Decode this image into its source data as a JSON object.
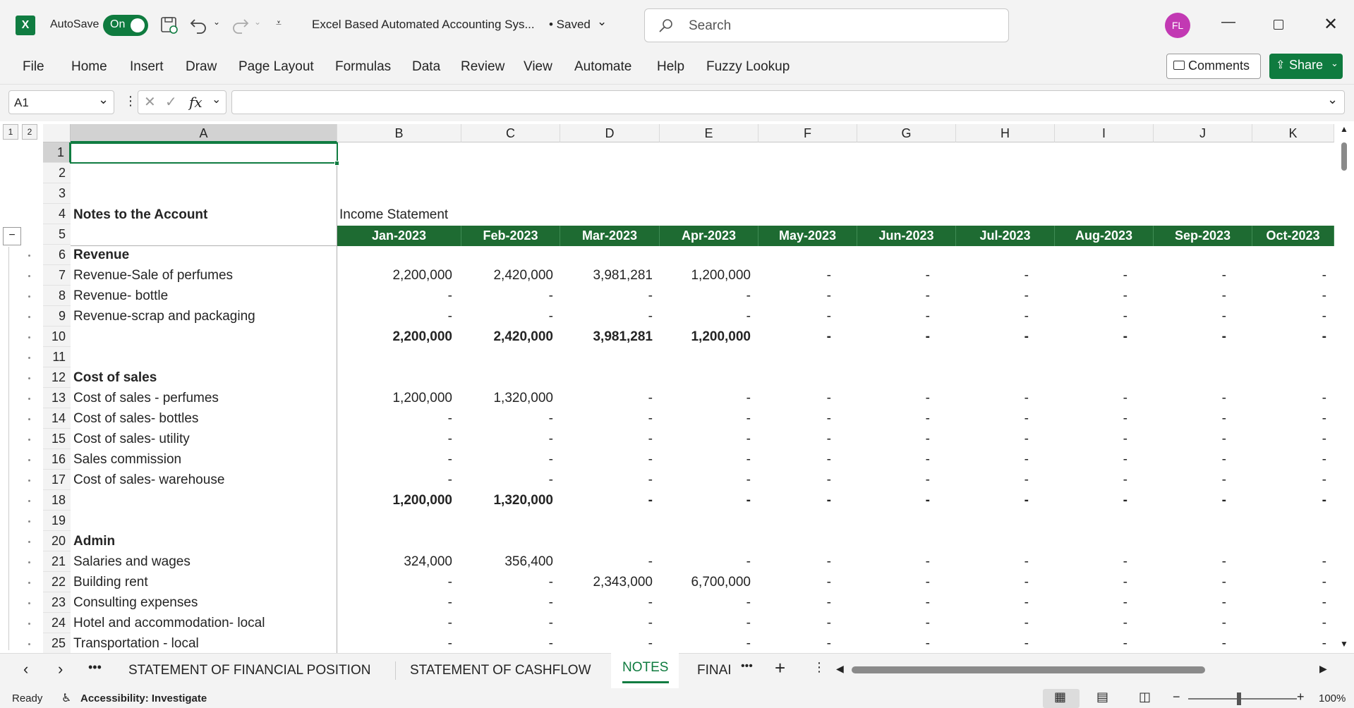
{
  "titlebar": {
    "autosave_label": "AutoSave",
    "autosave_state": "On",
    "doc_title": "Excel Based Automated Accounting Sys...",
    "save_status": "• Saved",
    "search_placeholder": "Search",
    "user_initials": "FL"
  },
  "menu": [
    "File",
    "Home",
    "Insert",
    "Draw",
    "Page Layout",
    "Formulas",
    "Data",
    "Review",
    "View",
    "Automate",
    "Help",
    "Fuzzy Lookup"
  ],
  "buttons": {
    "comments": "Comments",
    "share": "Share"
  },
  "formula_bar": {
    "name_box": "A1",
    "fx": "fx",
    "formula": ""
  },
  "outline_levels": [
    "1",
    "2"
  ],
  "columns": [
    "A",
    "B",
    "C",
    "D",
    "E",
    "F",
    "G",
    "H",
    "I",
    "J",
    "K"
  ],
  "sheet_heading_a": "Notes to the Account",
  "sheet_heading_b": "Income Statement",
  "months": [
    "Jan-2023",
    "Feb-2023",
    "Mar-2023",
    "Apr-2023",
    "May-2023",
    "Jun-2023",
    "Jul-2023",
    "Aug-2023",
    "Sep-2023",
    "Oct-2023"
  ],
  "rows": [
    {
      "n": "1",
      "label": "",
      "vals": []
    },
    {
      "n": "2",
      "label": "",
      "vals": []
    },
    {
      "n": "3",
      "label": "",
      "vals": []
    },
    {
      "n": "4",
      "label": "",
      "vals": []
    },
    {
      "n": "5",
      "label": "",
      "vals": []
    },
    {
      "n": "6",
      "label": "Revenue",
      "bold": true,
      "vals": []
    },
    {
      "n": "7",
      "label": "Revenue-Sale of perfumes",
      "vals": [
        "2,200,000",
        "2,420,000",
        "3,981,281",
        "1,200,000",
        "-",
        "-",
        "-",
        "-",
        "-",
        "-"
      ]
    },
    {
      "n": "8",
      "label": "Revenue- bottle",
      "vals": [
        "-",
        "-",
        "-",
        "-",
        "-",
        "-",
        "-",
        "-",
        "-",
        "-"
      ]
    },
    {
      "n": "9",
      "label": "Revenue-scrap  and packaging",
      "vals": [
        "-",
        "-",
        "-",
        "-",
        "-",
        "-",
        "-",
        "-",
        "-",
        "-"
      ]
    },
    {
      "n": "10",
      "label": "",
      "bold": true,
      "vals": [
        "2,200,000",
        "2,420,000",
        "3,981,281",
        "1,200,000",
        "-",
        "-",
        "-",
        "-",
        "-",
        "-"
      ]
    },
    {
      "n": "11",
      "label": "",
      "vals": []
    },
    {
      "n": "12",
      "label": "Cost of sales",
      "bold": true,
      "vals": []
    },
    {
      "n": "13",
      "label": "Cost of sales - perfumes",
      "vals": [
        "1,200,000",
        "1,320,000",
        "-",
        "-",
        "-",
        "-",
        "-",
        "-",
        "-",
        "-"
      ]
    },
    {
      "n": "14",
      "label": "Cost of sales- bottles",
      "vals": [
        "-",
        "-",
        "-",
        "-",
        "-",
        "-",
        "-",
        "-",
        "-",
        "-"
      ]
    },
    {
      "n": "15",
      "label": "Cost of sales- utility",
      "vals": [
        "-",
        "-",
        "-",
        "-",
        "-",
        "-",
        "-",
        "-",
        "-",
        "-"
      ]
    },
    {
      "n": "16",
      "label": "Sales commission",
      "vals": [
        "-",
        "-",
        "-",
        "-",
        "-",
        "-",
        "-",
        "-",
        "-",
        "-"
      ]
    },
    {
      "n": "17",
      "label": "Cost of sales-  warehouse",
      "vals": [
        "-",
        "-",
        "-",
        "-",
        "-",
        "-",
        "-",
        "-",
        "-",
        "-"
      ]
    },
    {
      "n": "18",
      "label": "",
      "bold": true,
      "vals": [
        "1,200,000",
        "1,320,000",
        "-",
        "-",
        "-",
        "-",
        "-",
        "-",
        "-",
        "-"
      ]
    },
    {
      "n": "19",
      "label": "",
      "vals": []
    },
    {
      "n": "20",
      "label": "Admin",
      "bold": true,
      "vals": []
    },
    {
      "n": "21",
      "label": "Salaries and wages",
      "vals": [
        "324,000",
        "356,400",
        "-",
        "-",
        "-",
        "-",
        "-",
        "-",
        "-",
        "-"
      ]
    },
    {
      "n": "22",
      "label": "Building rent",
      "vals": [
        "-",
        "-",
        "2,343,000",
        "6,700,000",
        "-",
        "-",
        "-",
        "-",
        "-",
        "-"
      ]
    },
    {
      "n": "23",
      "label": "Consulting expenses",
      "vals": [
        "-",
        "-",
        "-",
        "-",
        "-",
        "-",
        "-",
        "-",
        "-",
        "-"
      ]
    },
    {
      "n": "24",
      "label": "Hotel and accommodation- local",
      "vals": [
        "-",
        "-",
        "-",
        "-",
        "-",
        "-",
        "-",
        "-",
        "-",
        "-"
      ]
    },
    {
      "n": "25",
      "label": "Transportation - local",
      "vals": [
        "-",
        "-",
        "-",
        "-",
        "-",
        "-",
        "-",
        "-",
        "-",
        "-"
      ]
    }
  ],
  "sheet_tabs": [
    "STATEMENT OF FINANCIAL POSITION",
    "STATEMENT OF CASHFLOW",
    "NOTES",
    "FINAI"
  ],
  "active_tab": "NOTES",
  "status": {
    "ready": "Ready",
    "accessibility": "Accessibility: Investigate",
    "zoom": "100%"
  },
  "colors": {
    "excel_green": "#107c41",
    "header_fill": "#1e6b32",
    "avatar": "#c239b3"
  }
}
